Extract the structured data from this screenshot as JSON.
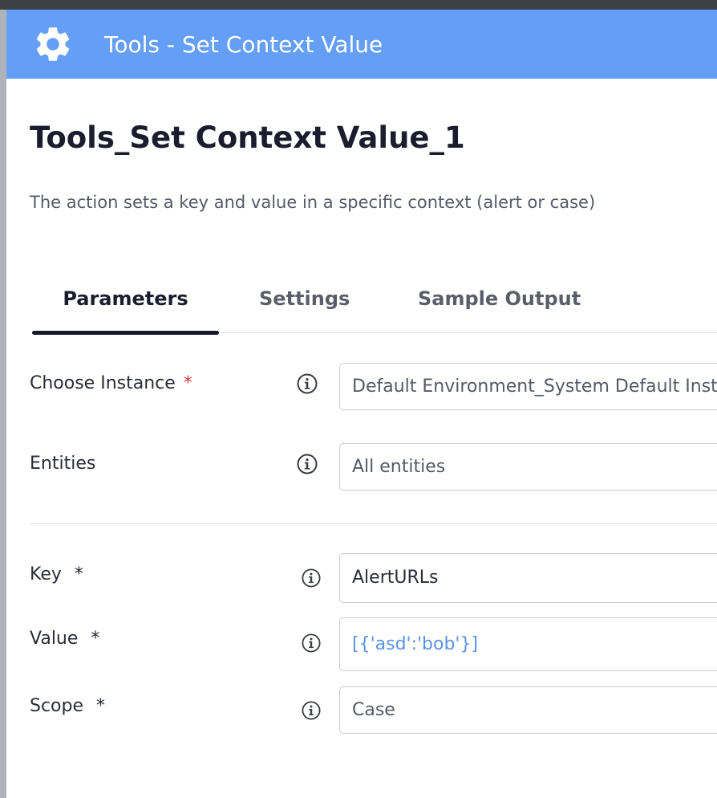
{
  "modal": {
    "header_title": "Tools - Set Context Value",
    "action_title": "Tools_Set Context Value_1",
    "description": "The action sets a key and value in a specific context (alert or case)"
  },
  "tabs": [
    {
      "label": "Parameters",
      "active": true
    },
    {
      "label": "Settings",
      "active": false
    },
    {
      "label": "Sample Output",
      "active": false
    }
  ],
  "fields": {
    "instance": {
      "label": "Choose Instance",
      "required_mark": "*",
      "value": "Default Environment_System Default Instance"
    },
    "entities": {
      "label": "Entities",
      "value": "All entities"
    },
    "key": {
      "label": "Key",
      "required_mark": "*",
      "value": "AlertURLs"
    },
    "value": {
      "label": "Value",
      "required_mark": "*",
      "value": "[{'asd':'bob'}]"
    },
    "scope": {
      "label": "Scope",
      "required_mark": "*",
      "value": "Case"
    }
  },
  "colors": {
    "header_bg": "#649ff5",
    "required_red": "#e23b3b",
    "value_link_blue": "#5b93e6"
  },
  "icons": {
    "header": "gear-icon",
    "field_info": "info-icon"
  }
}
